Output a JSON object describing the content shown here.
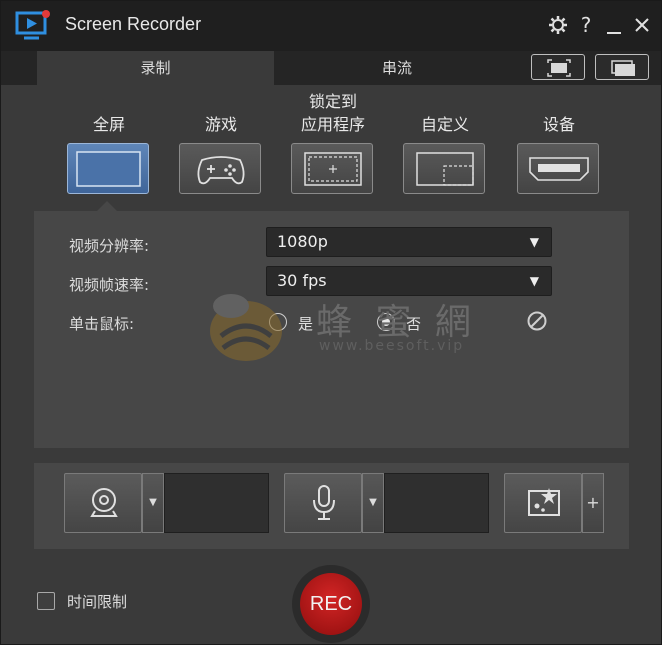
{
  "window": {
    "title": "Screen Recorder"
  },
  "colors": {
    "accent": "#4f78ad",
    "rec": "#c41a1a",
    "logo_blue": "#2f8fe0"
  },
  "titlebar": {
    "help_glyph": "?",
    "min_glyph": "—",
    "close_glyph": "✕"
  },
  "tabs": [
    {
      "label": "录制",
      "active": true
    },
    {
      "label": "串流",
      "active": false
    }
  ],
  "modes": [
    {
      "label": "全屏",
      "icon": "fullscreen-icon",
      "active": true
    },
    {
      "label": "游戏",
      "icon": "gamepad-icon",
      "active": false
    },
    {
      "label_line1": "锁定到",
      "label_line2": "应用程序",
      "icon": "lock-app-icon",
      "active": false
    },
    {
      "label": "自定义",
      "icon": "custom-area-icon",
      "active": false
    },
    {
      "label": "设备",
      "icon": "hdmi-device-icon",
      "active": false
    }
  ],
  "settings": {
    "resolution_label": "视频分辨率:",
    "resolution_value": "1080p",
    "fps_label": "视频帧速率:",
    "fps_value": "30 fps",
    "click_label": "单击鼠标:",
    "click_yes": "是",
    "click_no": "否",
    "click_selected": "否"
  },
  "watermark": {
    "text": "蜂 蜜 網",
    "sub": "www.beesoft.vip"
  },
  "device_bar": {
    "webcam_icon": "webcam-icon",
    "mic_icon": "microphone-icon",
    "effects_icon": "effects-icon",
    "dropdown_glyph": "▼",
    "plus_glyph": "+"
  },
  "bottom": {
    "time_limit_label": "时间限制",
    "rec_label": "REC"
  }
}
